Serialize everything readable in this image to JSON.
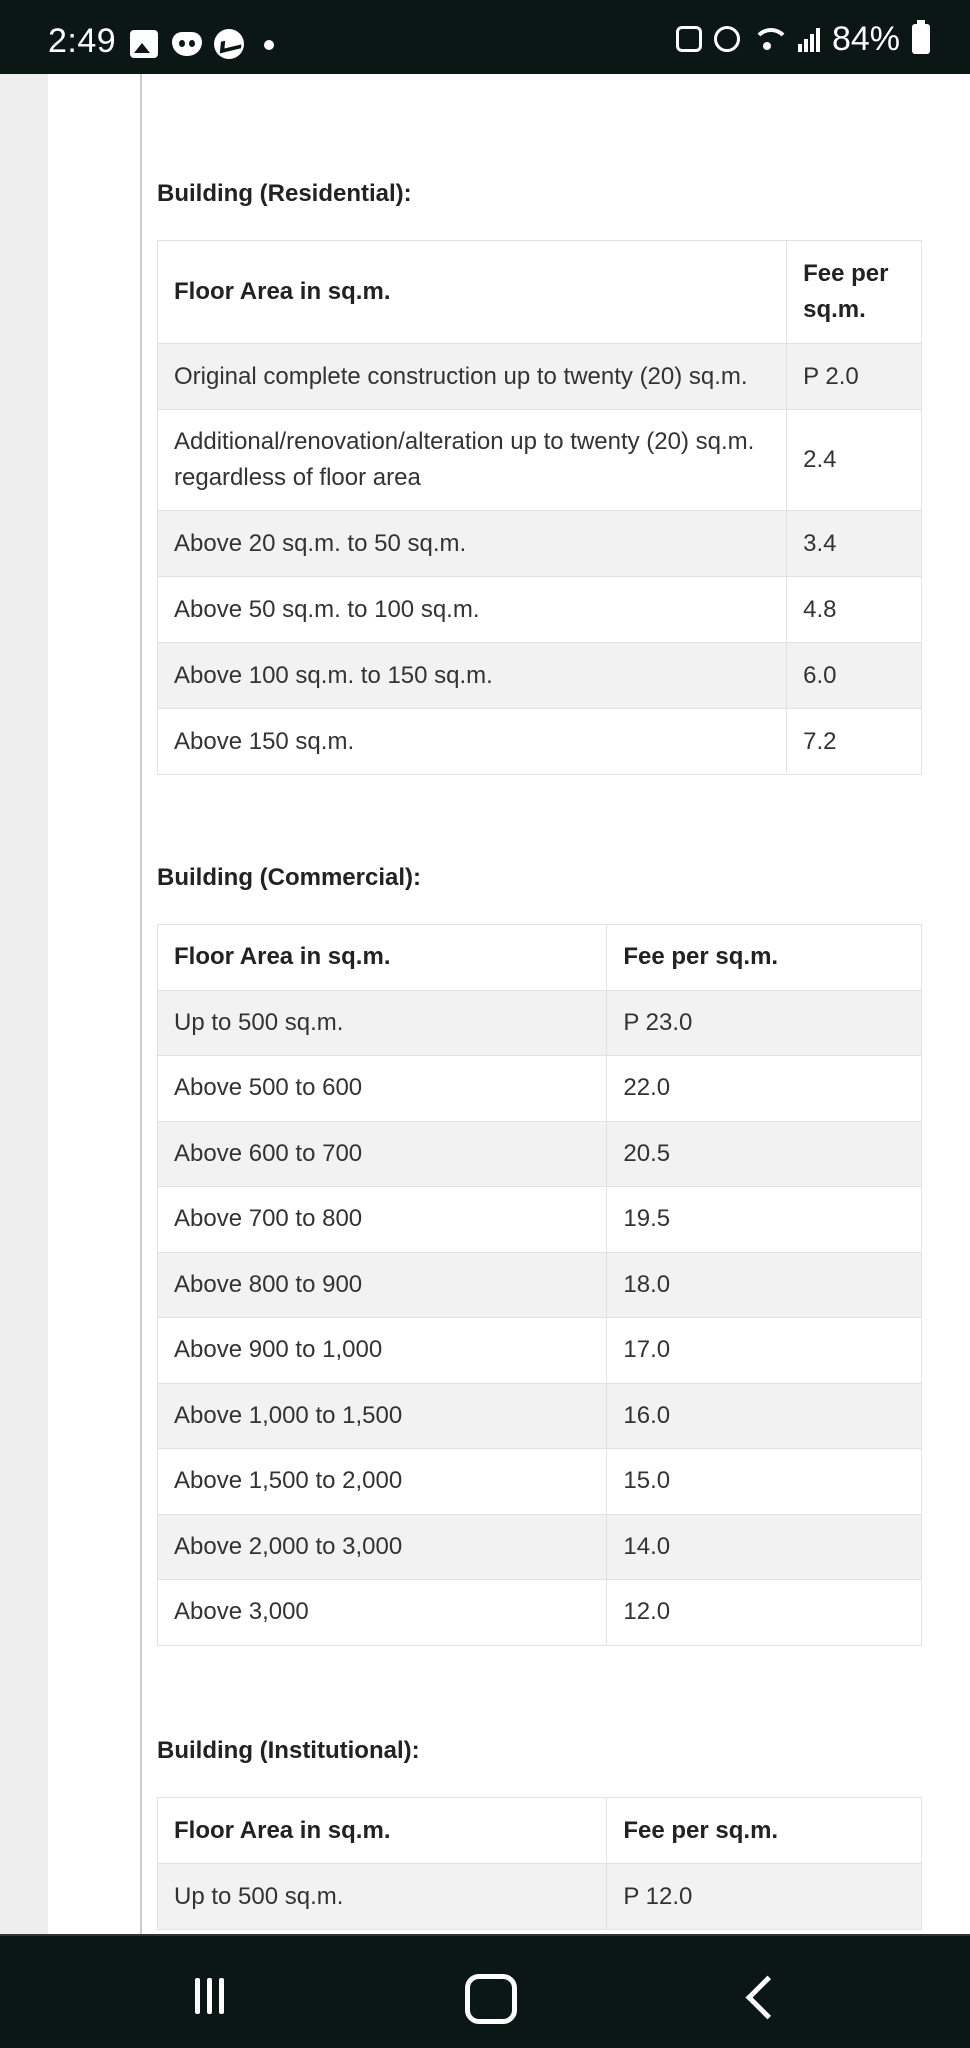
{
  "status_bar": {
    "time": "2:49",
    "battery_percent": "84%",
    "left_icons": [
      "gallery-icon",
      "discord-icon",
      "messenger-icon",
      "notification-dot"
    ],
    "right_icons": [
      "recycle-icon",
      "alarm-icon",
      "wifi-icon",
      "signal-icon",
      "battery-icon"
    ]
  },
  "residential": {
    "title": "Building (Residential):",
    "header_area": "Floor Area in sq.m.",
    "header_fee": "Fee per sq.m.",
    "rows": [
      {
        "area": "Original complete construction up to twenty (20) sq.m.",
        "fee": "P 2.0"
      },
      {
        "area": "Additional/renovation/alteration up to twenty (20) sq.m. regardless of floor area",
        "fee": "2.4"
      },
      {
        "area": "Above 20 sq.m. to 50 sq.m.",
        "fee": "3.4"
      },
      {
        "area": "Above 50 sq.m. to 100 sq.m.",
        "fee": "4.8"
      },
      {
        "area": "Above 100 sq.m. to 150 sq.m.",
        "fee": "6.0"
      },
      {
        "area": "Above 150 sq.m.",
        "fee": "7.2"
      }
    ]
  },
  "commercial": {
    "title": "Building (Commercial):",
    "header_area": "Floor Area in sq.m.",
    "header_fee": "Fee per sq.m.",
    "rows": [
      {
        "area": "Up to 500 sq.m.",
        "fee": "P 23.0"
      },
      {
        "area": "Above 500 to 600",
        "fee": "22.0"
      },
      {
        "area": "Above 600 to 700",
        "fee": "20.5"
      },
      {
        "area": "Above 700 to 800",
        "fee": "19.5"
      },
      {
        "area": "Above 800 to 900",
        "fee": "18.0"
      },
      {
        "area": "Above 900 to 1,000",
        "fee": "17.0"
      },
      {
        "area": "Above 1,000 to 1,500",
        "fee": "16.0"
      },
      {
        "area": "Above 1,500 to 2,000",
        "fee": "15.0"
      },
      {
        "area": "Above 2,000 to 3,000",
        "fee": "14.0"
      },
      {
        "area": "Above 3,000",
        "fee": "12.0"
      }
    ]
  },
  "institutional": {
    "title": "Building (Institutional):",
    "header_area": "Floor Area in sq.m.",
    "header_fee": "Fee per sq.m.",
    "rows": [
      {
        "area": "Up to 500 sq.m.",
        "fee": "P 12.0"
      }
    ]
  },
  "nav_bar": {
    "buttons": [
      "recents-icon",
      "home-icon",
      "back-icon"
    ]
  }
}
